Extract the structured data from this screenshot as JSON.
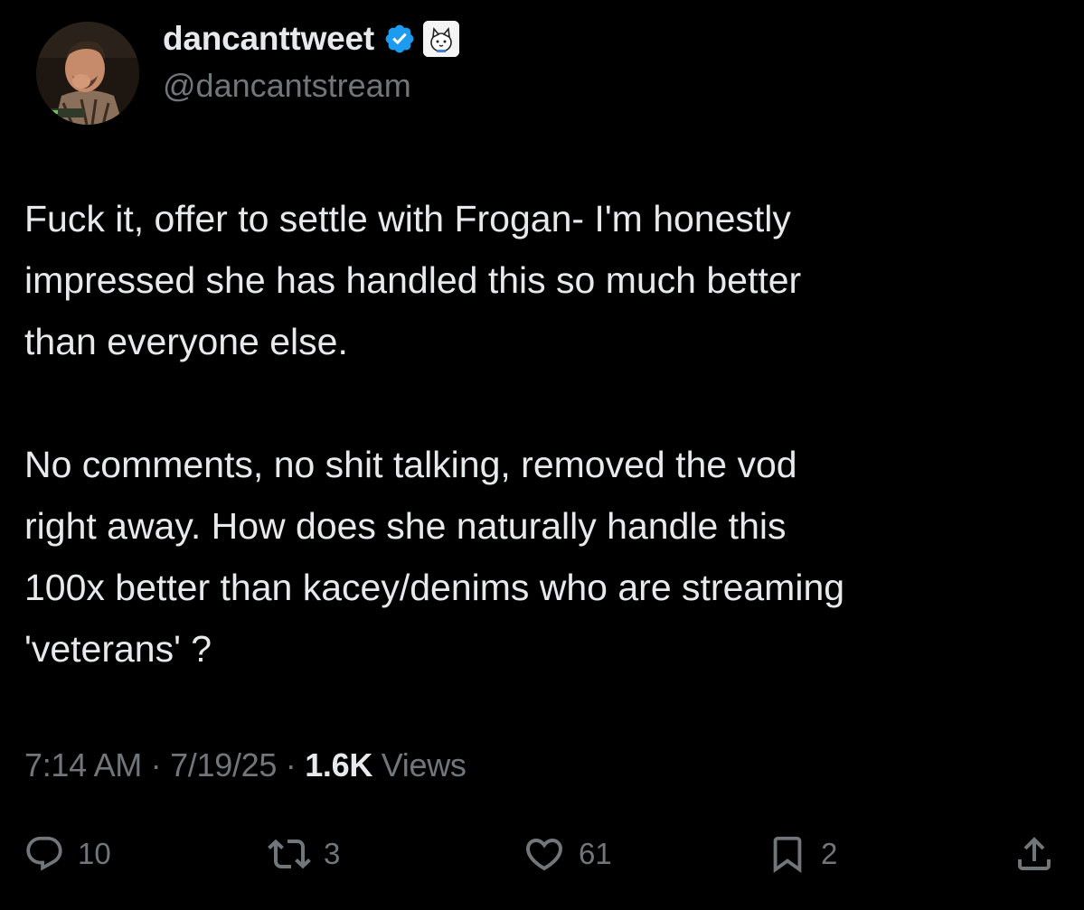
{
  "author": {
    "display_name": "dancanttweet",
    "handle": "@dancantstream",
    "verified_icon": "verified-badge-icon",
    "affiliate_icon": "affiliate-badge-icon",
    "avatar_icon": "profile-avatar"
  },
  "tweet": {
    "paragraph_1": "Fuck it, offer to settle with Frogan- I'm honestly\nimpressed she has handled this so much better\nthan everyone else.",
    "paragraph_2": "No comments, no shit talking, removed the vod\nright away. How does she naturally handle this\n100x better than kacey/denims who are streaming\n'veterans' ?"
  },
  "meta": {
    "time": "7:14 AM",
    "separator": " · ",
    "date": "7/19/25",
    "views_count": "1.6K",
    "views_label": " Views"
  },
  "actions": {
    "reply": {
      "icon": "reply-icon",
      "count": "10"
    },
    "retweet": {
      "icon": "retweet-icon",
      "count": "3"
    },
    "like": {
      "icon": "heart-icon",
      "count": "61"
    },
    "bookmark": {
      "icon": "bookmark-icon",
      "count": "2"
    },
    "share": {
      "icon": "share-icon"
    }
  },
  "colors": {
    "background": "#000000",
    "primary_text": "#e7e9ea",
    "secondary_text": "#71767b",
    "verified_blue": "#1d9bf0"
  }
}
